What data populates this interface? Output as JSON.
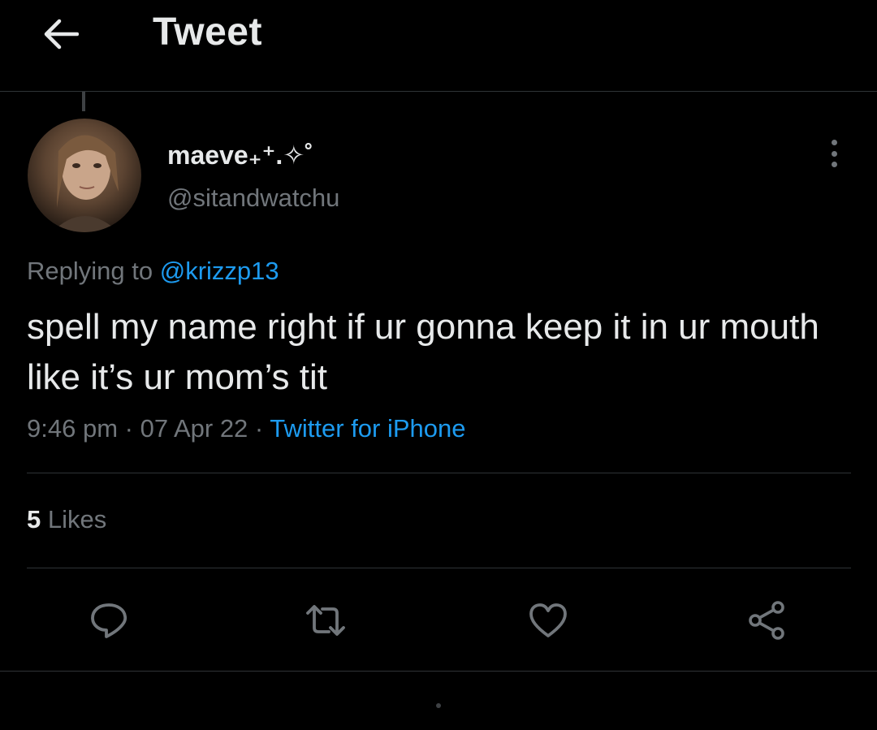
{
  "header": {
    "title": "Tweet",
    "back_icon": "arrow-left-icon"
  },
  "author": {
    "display_name": "maeve₊⁺.✧˚",
    "handle": "@sitandwatchu",
    "avatar": "avatar-photo"
  },
  "reply": {
    "prefix": "Replying to",
    "target": "@krizzp13"
  },
  "tweet": {
    "text": "spell my name right if ur gonna keep it in ur mouth like it’s ur mom’s tit"
  },
  "meta": {
    "time": "9:46 pm",
    "separator_1": " · ",
    "date": "07 Apr 22",
    "separator_2": " · ",
    "source": "Twitter for iPhone"
  },
  "stats": {
    "likes_count": "5",
    "likes_label": "Likes"
  },
  "actions": {
    "reply_icon": "reply-icon",
    "retweet_icon": "retweet-icon",
    "like_icon": "heart-icon",
    "share_icon": "share-icon"
  },
  "colors": {
    "background": "#000000",
    "text": "#e7e9ea",
    "secondary": "#71767b",
    "accent": "#1d9bf0",
    "divider": "#2f3336"
  }
}
